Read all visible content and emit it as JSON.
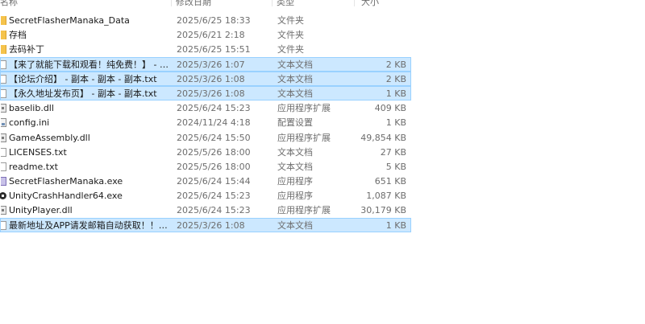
{
  "columns": {
    "name": "名称",
    "date": "修改日期",
    "type": "类型",
    "size": "大小"
  },
  "files": [
    {
      "name": "SecretFlasherManaka_Data",
      "date": "2025/6/25 18:33",
      "type": "文件夹",
      "size": "",
      "icon": "folder-icon",
      "selected": false
    },
    {
      "name": "存档",
      "date": "2025/6/21 2:18",
      "type": "文件夹",
      "size": "",
      "icon": "folder-icon",
      "selected": false
    },
    {
      "name": "去码补丁",
      "date": "2025/6/25 15:51",
      "type": "文件夹",
      "size": "",
      "icon": "folder-icon",
      "selected": false
    },
    {
      "name": "【来了就能下载和观看！纯免费！】 - 副...",
      "date": "2025/3/26 1:07",
      "type": "文本文档",
      "size": "2 KB",
      "icon": "text-file-icon",
      "selected": true
    },
    {
      "name": "【论坛介绍】 - 副本 - 副本 - 副本.txt",
      "date": "2025/3/26 1:08",
      "type": "文本文档",
      "size": "2 KB",
      "icon": "text-file-icon",
      "selected": true
    },
    {
      "name": "【永久地址发布页】 - 副本 - 副本.txt",
      "date": "2025/3/26 1:08",
      "type": "文本文档",
      "size": "1 KB",
      "icon": "text-file-icon",
      "selected": true
    },
    {
      "name": "baselib.dll",
      "date": "2025/6/24 15:23",
      "type": "应用程序扩展",
      "size": "409 KB",
      "icon": "dll-file-icon",
      "selected": false
    },
    {
      "name": "config.ini",
      "date": "2024/11/24 4:18",
      "type": "配置设置",
      "size": "1 KB",
      "icon": "config-file-icon",
      "selected": false
    },
    {
      "name": "GameAssembly.dll",
      "date": "2025/6/24 15:50",
      "type": "应用程序扩展",
      "size": "49,854 KB",
      "icon": "dll-file-icon",
      "selected": false
    },
    {
      "name": "LICENSES.txt",
      "date": "2025/5/26 18:00",
      "type": "文本文档",
      "size": "27 KB",
      "icon": "text-file-icon",
      "selected": false
    },
    {
      "name": "readme.txt",
      "date": "2025/5/26 18:00",
      "type": "文本文档",
      "size": "5 KB",
      "icon": "text-file-icon",
      "selected": false
    },
    {
      "name": "SecretFlasherManaka.exe",
      "date": "2025/6/24 15:44",
      "type": "应用程序",
      "size": "651 KB",
      "icon": "app-exe-icon",
      "selected": false
    },
    {
      "name": "UnityCrashHandler64.exe",
      "date": "2025/6/24 15:23",
      "type": "应用程序",
      "size": "1,087 KB",
      "icon": "unity-exe-icon",
      "selected": false
    },
    {
      "name": "UnityPlayer.dll",
      "date": "2025/6/24 15:23",
      "type": "应用程序扩展",
      "size": "30,179 KB",
      "icon": "dll-file-icon",
      "selected": false
    },
    {
      "name": "最新地址及APP请发邮箱自动获取！！！...",
      "date": "2025/3/26 1:08",
      "type": "文本文档",
      "size": "1 KB",
      "icon": "text-file-icon",
      "selected": true
    }
  ]
}
